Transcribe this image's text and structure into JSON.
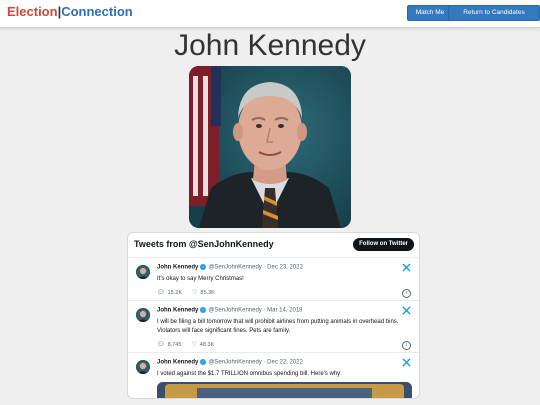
{
  "header": {
    "logo_part1": "Election",
    "logo_sep": "|",
    "logo_part2": "Connection",
    "match_label": "Match Me",
    "return_label": "Return to Candidates"
  },
  "candidate": {
    "name": "John Kennedy"
  },
  "embed": {
    "title": "Tweets from @SenJohnKennedy",
    "follow_label": "Follow on Twitter",
    "tweets": [
      {
        "author": "John Kennedy",
        "handle": "@SenJohnKennedy",
        "date": "Dec 23, 2022",
        "text": "It's okay to say Merry Christmas!",
        "replies": "15.2K",
        "likes": "85.3K"
      },
      {
        "author": "John Kennedy",
        "handle": "@SenJohnKennedy",
        "date": "Mar 14, 2018",
        "text": "I will be filing a bill tomorrow that will prohibit airlines from putting animals in overhead bins. Violators will face significant fines. Pets are family.",
        "replies": "8,745",
        "likes": "48.3K"
      },
      {
        "author": "John Kennedy",
        "handle": "@SenJohnKennedy",
        "date": "Dec 22, 2022",
        "text": "I voted against the $1.7 TRILLION omnibus spending bill. Here's why:"
      }
    ]
  },
  "colors": {
    "brand_red": "#d0493d",
    "brand_blue": "#2f6fb3",
    "button_blue": "#3279be",
    "twitter_blue": "#1d9bf0"
  }
}
